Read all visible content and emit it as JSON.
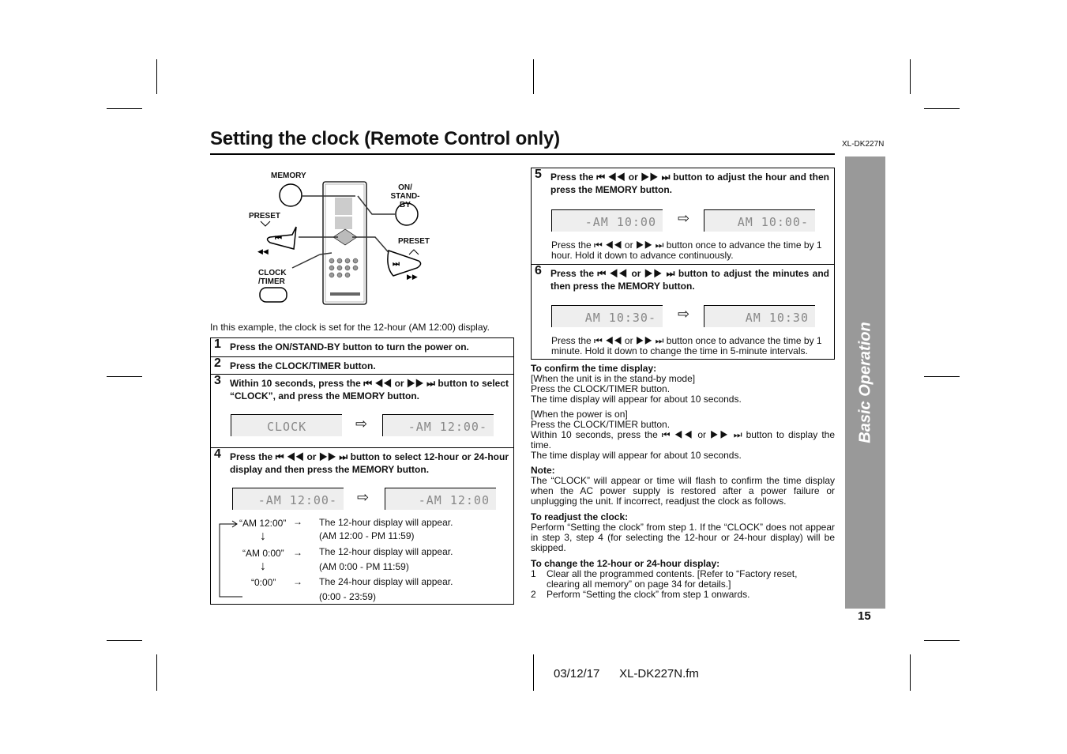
{
  "title": "Setting the clock (Remote Control only)",
  "model": "XL-DK227N",
  "side_tab": "Basic Operation",
  "page_number": "15",
  "footer": {
    "date": "03/12/17",
    "file": "XL-DK227N.fm"
  },
  "diagram": {
    "memory": "MEMORY",
    "on_standby": "ON/ STAND-BY",
    "preset_down": "PRESET",
    "preset_up": "PRESET",
    "clock_timer": "CLOCK /TIMER"
  },
  "intro": "In this example, the clock is set for the 12-hour (AM 12:00) display.",
  "steps": [
    {
      "n": "1",
      "text": "Press the ON/STAND-BY button to turn the power on."
    },
    {
      "n": "2",
      "text": "Press the CLOCK/TIMER button."
    },
    {
      "n": "3",
      "text": "Within 10 seconds, press the ⏮ ◀◀ or ▶▶ ⏭ button to select “CLOCK”, and press the MEMORY button.",
      "lcd": [
        "CLOCK",
        "-AM 12:00-"
      ]
    },
    {
      "n": "4",
      "text": "Press the ⏮ ◀◀ or ▶▶ ⏭ button to select 12-hour or 24-hour display and then press the MEMORY button.",
      "lcd": [
        "-AM 12:00-",
        "-AM 12:00"
      ],
      "cycle": [
        {
          "mode": "“AM 12:00”",
          "desc": "The 12-hour display will appear.",
          "range": "(AM 12:00 - PM 11:59)"
        },
        {
          "mode": "“AM 0:00”",
          "desc": "The 12-hour display will appear.",
          "range": "(AM 0:00 - PM 11:59)"
        },
        {
          "mode": "“0:00”",
          "desc": "The 24-hour display will appear.",
          "range": "(0:00 - 23:59)"
        }
      ]
    },
    {
      "n": "5",
      "text": "Press the ⏮ ◀◀ or ▶▶ ⏭ button to adjust the hour and then press the MEMORY button.",
      "lcd": [
        "-AM 10:00",
        "AM 10:00-"
      ],
      "note": "Press the ⏮ ◀◀ or ▶▶ ⏭ button once to advance the time by 1 hour. Hold it down to advance continuously."
    },
    {
      "n": "6",
      "text": "Press the ⏮ ◀◀ or ▶▶ ⏭ button to adjust the minutes and then press the MEMORY button.",
      "lcd": [
        "AM 10:30-",
        "AM 10:30"
      ],
      "note": "Press the ⏮ ◀◀ or ▶▶ ⏭ button once to advance the time by 1 minute. Hold it down to change the time in 5-minute intervals."
    }
  ],
  "confirm": {
    "heading": "To confirm the time display:",
    "a": "[When the unit is in the stand-by mode]\nPress the CLOCK/TIMER button.\nThe time display will appear for about 10 seconds.",
    "b": "[When the power is on]\nPress the CLOCK/TIMER button.\nWithin 10 seconds, press the ⏮ ◀◀ or ▶▶ ⏭ button to display the time.\nThe time display will appear for about 10 seconds."
  },
  "note": {
    "heading": "Note:",
    "text": "The “CLOCK” will appear or time will flash to confirm the time display when the AC power supply is restored after a power failure or unplugging the unit. If incorrect, readjust the clock as follows."
  },
  "readjust": {
    "heading": "To readjust the clock:",
    "text": "Perform “Setting the clock” from step 1. If the “CLOCK” does not appear in step 3, step 4 (for selecting the 12-hour or 24-hour display) will be skipped."
  },
  "change": {
    "heading": "To change the 12-hour or 24-hour display:",
    "items": [
      {
        "n": "1",
        "text": "Clear all the programmed contents. [Refer to “Factory reset, clearing all memory” on page 34 for details.]"
      },
      {
        "n": "2",
        "text": "Perform “Setting the clock” from step 1 onwards."
      }
    ]
  }
}
